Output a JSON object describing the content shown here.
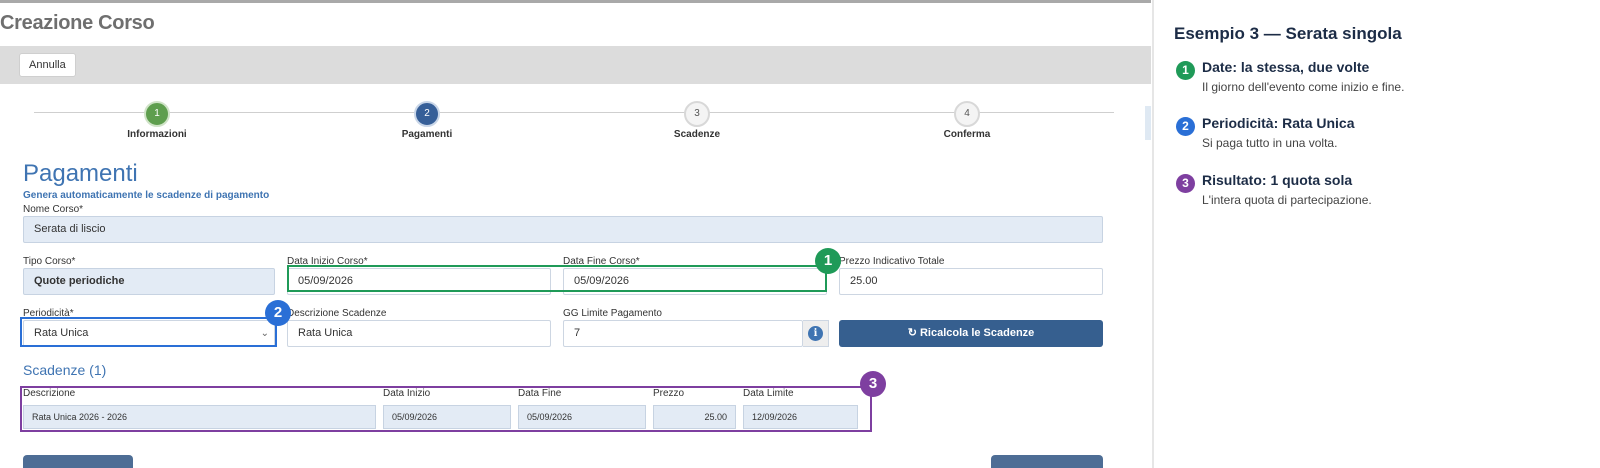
{
  "app": {
    "title": "Creazione Corso",
    "cancel_label": "Annulla"
  },
  "steps": [
    {
      "number": "1",
      "label": "Informazioni",
      "state": "done"
    },
    {
      "number": "2",
      "label": "Pagamenti",
      "state": "active"
    },
    {
      "number": "3",
      "label": "Scadenze",
      "state": "todo"
    },
    {
      "number": "4",
      "label": "Conferma",
      "state": "todo"
    }
  ],
  "section": {
    "title": "Pagamenti",
    "subtitle": "Genera automaticamente le scadenze di pagamento"
  },
  "form": {
    "course_name": {
      "label": "Nome Corso*",
      "value": "Serata di liscio"
    },
    "course_type": {
      "label": "Tipo Corso*",
      "value": "Quote periodiche"
    },
    "start_date": {
      "label": "Data Inizio Corso*",
      "value": "05/09/2026"
    },
    "end_date": {
      "label": "Data Fine Corso*",
      "value": "05/09/2026"
    },
    "total_price": {
      "label": "Prezzo Indicativo Totale",
      "value": "25.00"
    },
    "periodicity": {
      "label": "Periodicità*",
      "value": "Rata Unica"
    },
    "deadline_description": {
      "label": "Descrizione Scadenze",
      "value": "Rata Unica"
    },
    "payment_limit_days": {
      "label": "GG Limite Pagamento",
      "value": "7"
    },
    "recalculate_label": "↻ Ricalcola le Scadenze"
  },
  "deadlines": {
    "title": "Scadenze (1)",
    "columns": [
      "Descrizione",
      "Data Inizio",
      "Data Fine",
      "Prezzo",
      "Data Limite"
    ],
    "rows": [
      {
        "description": "Rata Unica 2026 - 2026",
        "start": "05/09/2026",
        "end": "05/09/2026",
        "price": "25.00",
        "limit": "12/09/2026"
      }
    ]
  },
  "annotations": {
    "badge1": "1",
    "badge2": "2",
    "badge3": "3"
  },
  "panel": {
    "title": "Esempio 3 — Serata singola",
    "notes": [
      {
        "number": "1",
        "heading": "Date: la stessa, due volte",
        "text": "Il giorno dell'evento come inizio e fine.",
        "color": "#1f9a58"
      },
      {
        "number": "2",
        "heading": "Periodicità: Rata Unica",
        "text": "Si paga tutto in una volta.",
        "color": "#2a6fd6"
      },
      {
        "number": "3",
        "heading": "Risultato: 1 quota sola",
        "text": "L'intera quota di partecipazione.",
        "color": "#7e3fa0"
      }
    ]
  },
  "colors": {
    "green": "#1f9a58",
    "blue": "#2a6fd6",
    "purple": "#7e3fa0",
    "primary": "#365f8f"
  },
  "icons": {
    "info": "info-icon",
    "select": "chevron-down-icon",
    "refresh": "refresh-icon"
  }
}
